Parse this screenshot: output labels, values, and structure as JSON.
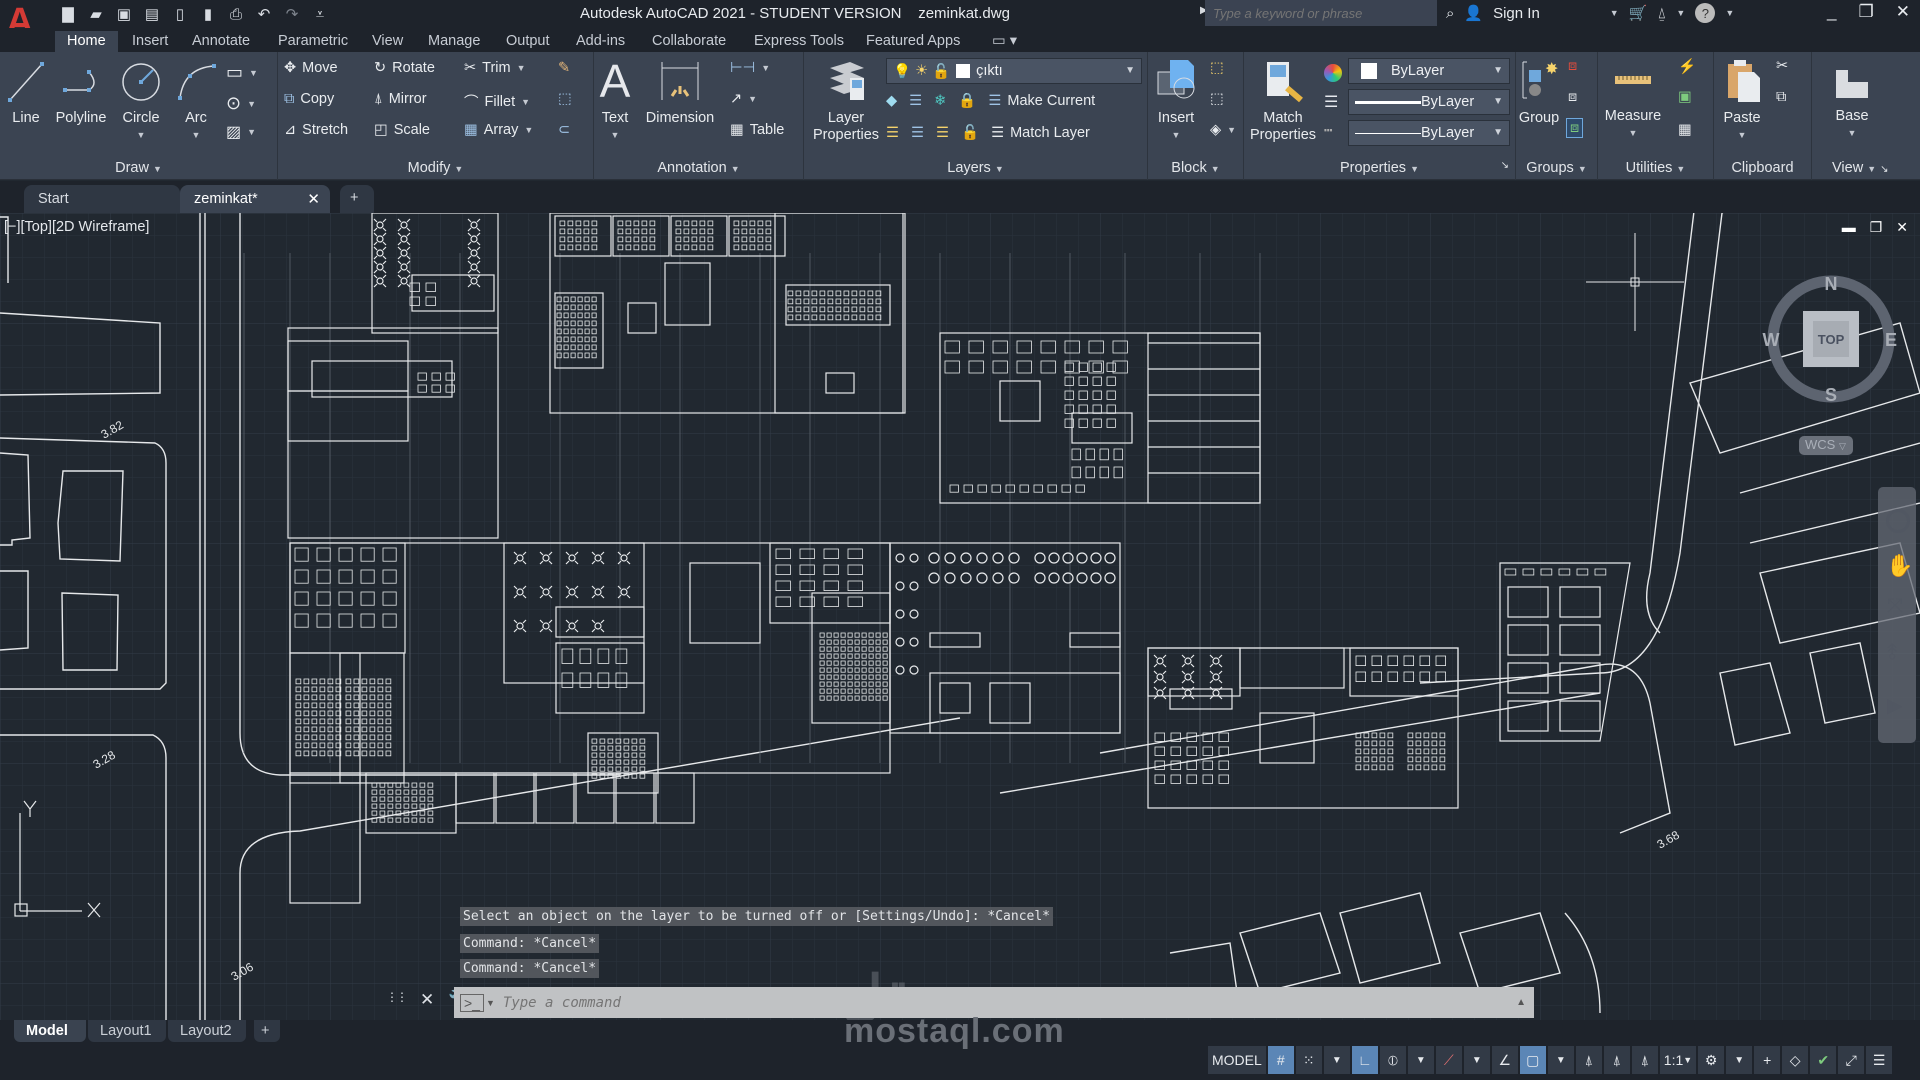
{
  "app": {
    "title": "Autodesk AutoCAD 2021 - STUDENT VERSION",
    "filename": "zeminkat.dwg",
    "logo": "A",
    "search_placeholder": "Type a keyword or phrase",
    "sign_in": "Sign In"
  },
  "quick_access": [
    "new-icon",
    "open-icon",
    "save-icon",
    "save-as-icon",
    "open-from-web-icon",
    "save-to-web-icon",
    "plot-icon",
    "undo-icon",
    "redo-icon",
    "customize-icon"
  ],
  "ribbon_tabs": [
    "Home",
    "Insert",
    "Annotate",
    "Parametric",
    "View",
    "Manage",
    "Output",
    "Add-ins",
    "Collaborate",
    "Express Tools",
    "Featured Apps"
  ],
  "active_ribbon_tab": "Home",
  "panels": {
    "draw": {
      "title": "Draw",
      "line": "Line",
      "polyline": "Polyline",
      "circle": "Circle",
      "arc": "Arc"
    },
    "modify": {
      "title": "Modify",
      "move": "Move",
      "rotate": "Rotate",
      "trim": "Trim",
      "copy": "Copy",
      "mirror": "Mirror",
      "fillet": "Fillet",
      "stretch": "Stretch",
      "scale": "Scale",
      "array": "Array"
    },
    "annotation": {
      "title": "Annotation",
      "text": "Text",
      "dimension": "Dimension",
      "table": "Table"
    },
    "layers": {
      "title": "Layers",
      "layer_properties_1": "Layer",
      "layer_properties_2": "Properties",
      "current_layer": "çıktı",
      "make_current": "Make Current",
      "match_layer": "Match Layer"
    },
    "block": {
      "title": "Block",
      "insert": "Insert"
    },
    "properties": {
      "title": "Properties",
      "match_1": "Match",
      "match_2": "Properties",
      "color": "ByLayer",
      "lineweight": "ByLayer",
      "linetype": "ByLayer"
    },
    "groups": {
      "title": "Groups",
      "group": "Group"
    },
    "utilities": {
      "title": "Utilities",
      "measure": "Measure"
    },
    "clipboard": {
      "title": "Clipboard",
      "paste": "Paste"
    },
    "view": {
      "title": "View",
      "base": "Base"
    }
  },
  "doc_tabs": [
    {
      "label": "Start"
    },
    {
      "label": "zeminkat*"
    }
  ],
  "viewport": {
    "label": "[−][Top][2D Wireframe]",
    "elevations": [
      "3.82",
      "3.28",
      "3.06",
      "3.68"
    ],
    "viewcube": {
      "top": "TOP",
      "n": "N",
      "s": "S",
      "e": "E",
      "w": "W",
      "wcs": "WCS"
    },
    "ucs": {
      "x": "X",
      "y": "Y"
    }
  },
  "command": {
    "history": [
      "Select an object on the layer to be turned off or [Settings/Undo]: *Cancel*",
      "Command: *Cancel*",
      "Command: *Cancel*"
    ],
    "placeholder": "Type a command"
  },
  "layout_tabs": [
    {
      "label": "Model"
    },
    {
      "label": "Layout1"
    },
    {
      "label": "Layout2"
    }
  ],
  "status": {
    "model": "MODEL",
    "scale": "1:1"
  },
  "watermark": "mostaql.com"
}
